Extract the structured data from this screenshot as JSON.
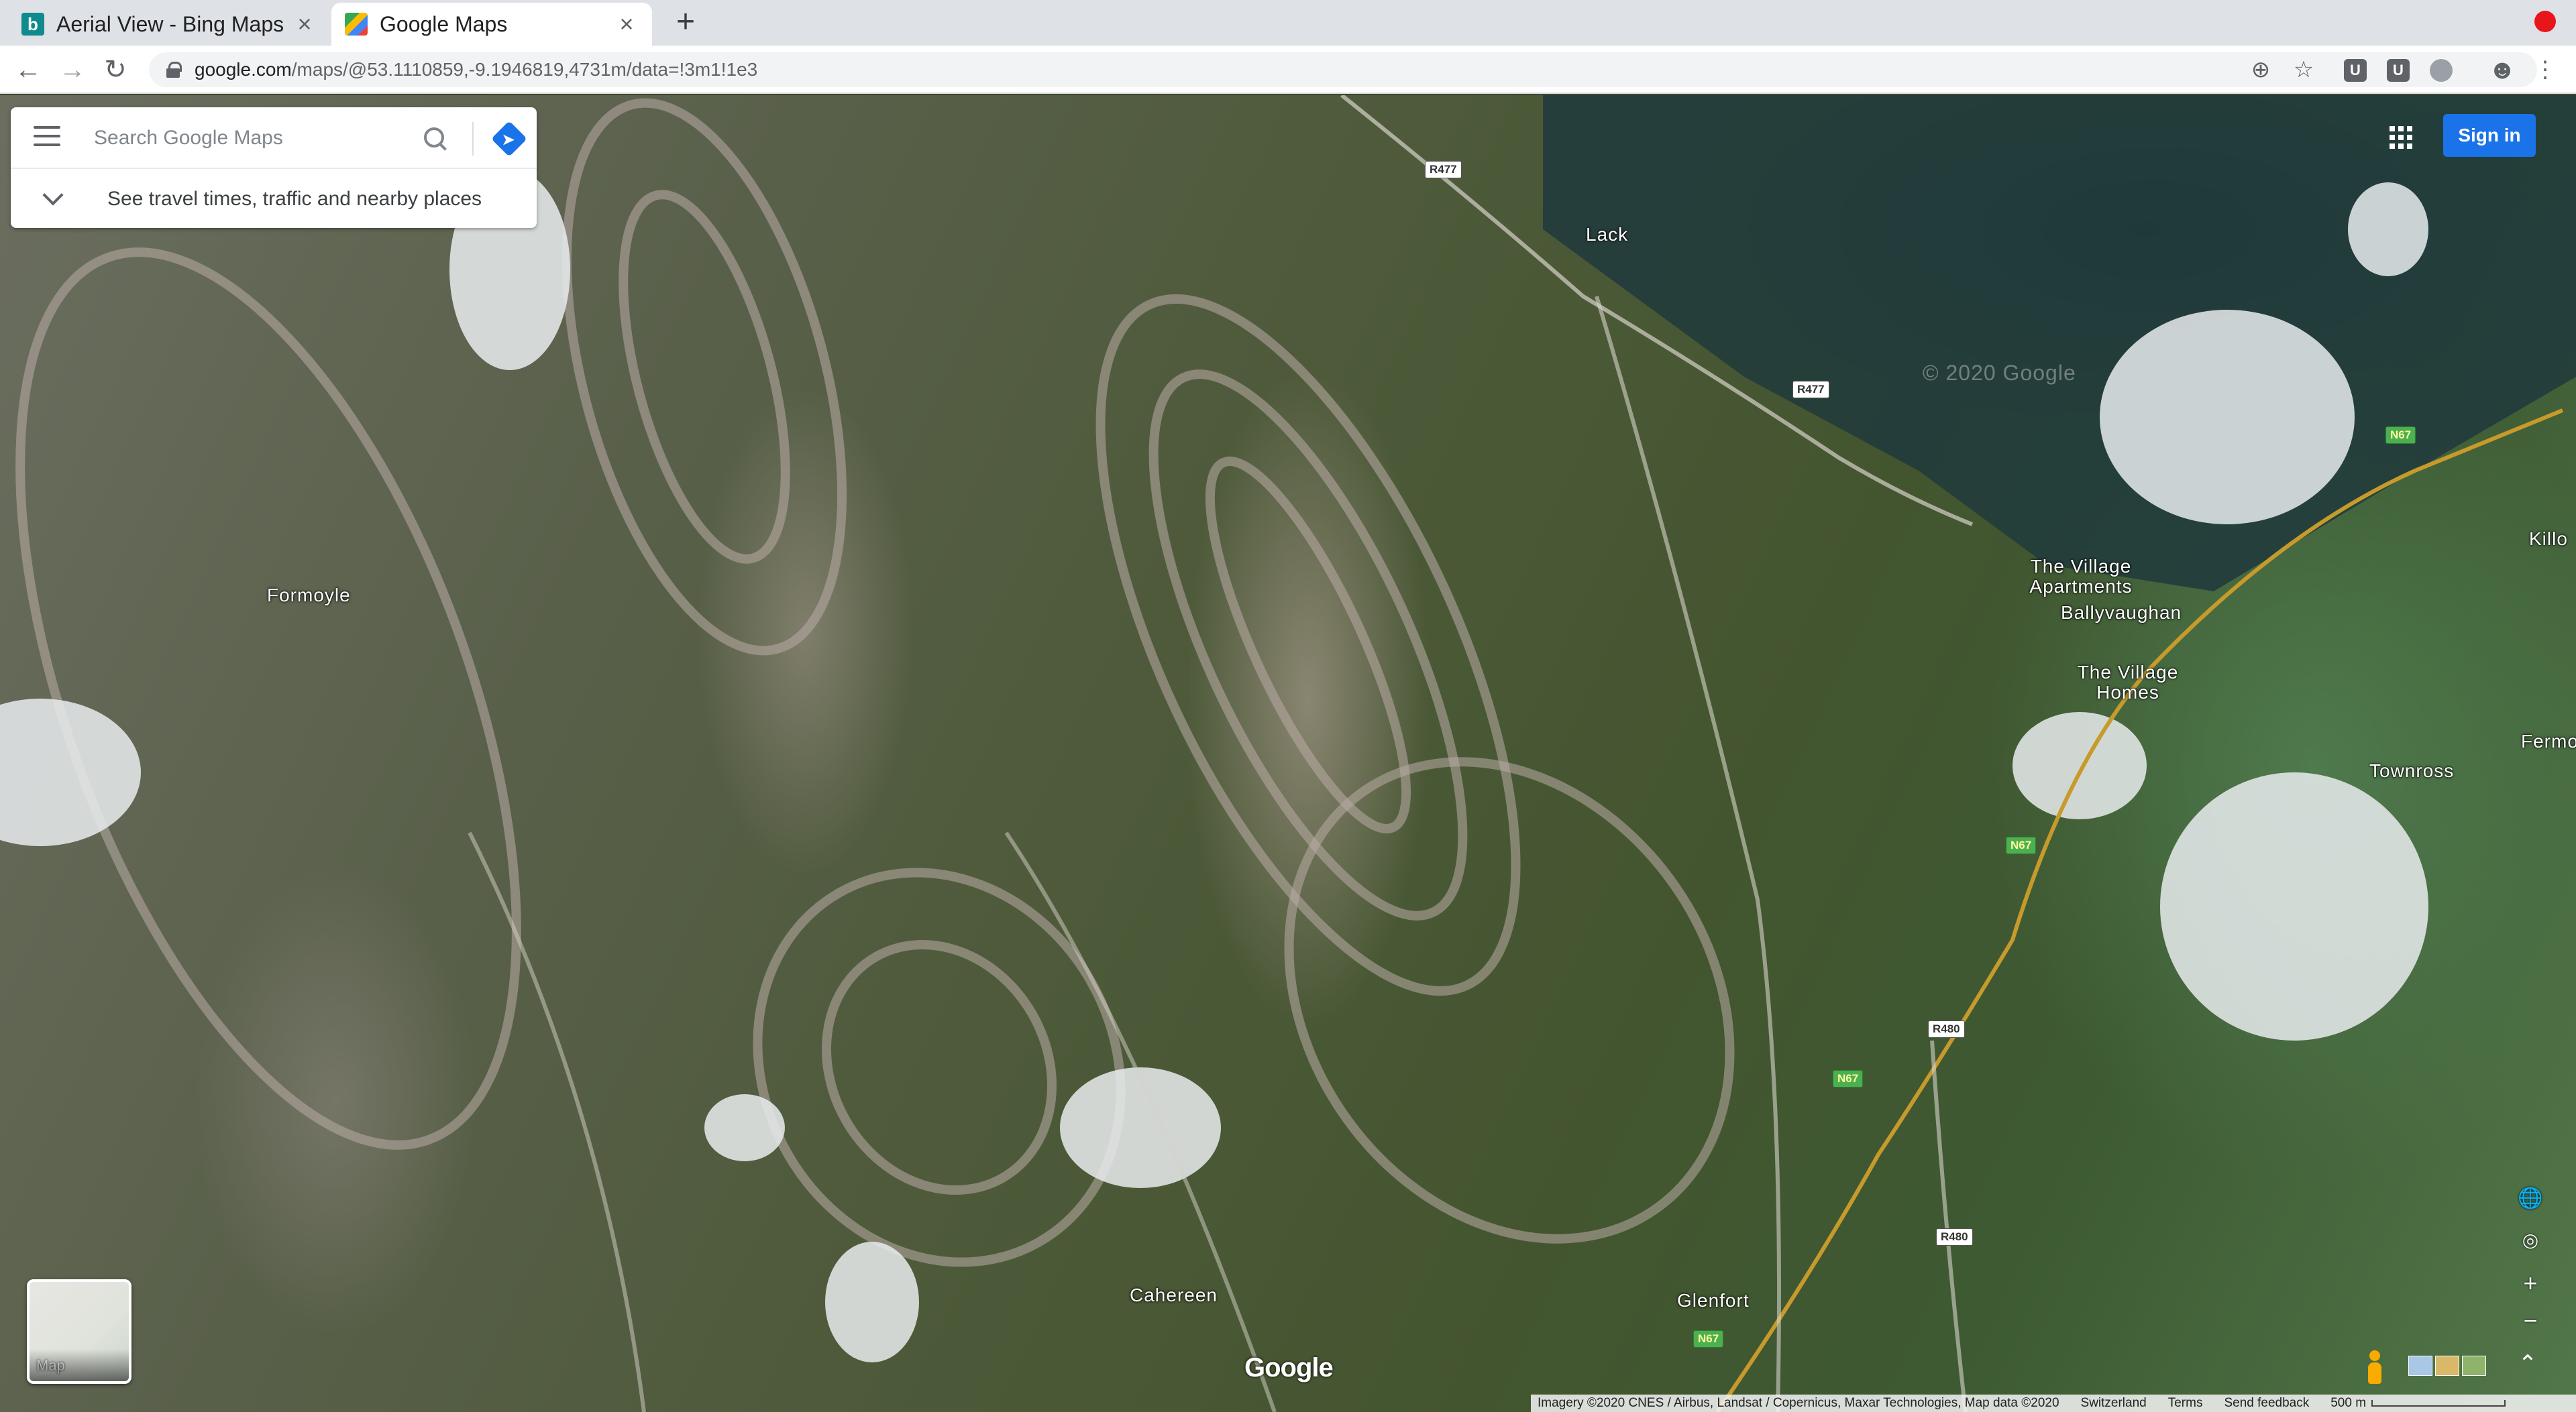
{
  "browser": {
    "tabs": [
      {
        "title": "Aerial View - Bing Maps",
        "active": false,
        "icon": "bing-icon"
      },
      {
        "title": "Google Maps",
        "active": true,
        "icon": "google-maps-icon"
      }
    ],
    "new_tab_label": "+",
    "close_label": "×",
    "url_host": "google.com",
    "url_path": "/maps/@53.1110859,-9.1946819,4731m/data=!3m1!1e3",
    "ext_u1": "U",
    "ext_u2": "U"
  },
  "search": {
    "placeholder": "Search Google Maps",
    "travel_text": "See travel times, traffic and nearby places"
  },
  "header": {
    "signin_label": "Sign in"
  },
  "places": [
    {
      "name": "Lack"
    },
    {
      "name": "Formoyle"
    },
    {
      "name": "The Village Apartments"
    },
    {
      "name": "Ballyvaughan"
    },
    {
      "name": "The Village Homes"
    },
    {
      "name": "Townross"
    },
    {
      "name": "Killo"
    },
    {
      "name": "Fermo"
    },
    {
      "name": "Cahereen"
    },
    {
      "name": "Glenfort"
    }
  ],
  "roads": [
    {
      "label": "R477"
    },
    {
      "label": "R477"
    },
    {
      "label": "N67"
    },
    {
      "label": "N67"
    },
    {
      "label": "N67"
    },
    {
      "label": "N67"
    },
    {
      "label": "R480"
    },
    {
      "label": "R480"
    }
  ],
  "watermark": "© 2020 Google",
  "layer_thumb_label": "Map",
  "logo": "Google",
  "footer": {
    "imagery": "Imagery ©2020 CNES / Airbus, Landsat / Copernicus, Maxar Technologies, Map data ©2020",
    "region": "Switzerland",
    "terms": "Terms",
    "feedback": "Send feedback",
    "scale": "500 m"
  },
  "controls": {
    "zoom_in": "+",
    "zoom_out": "−",
    "expand": "⌃"
  },
  "colors": {
    "accent": "#1a73e8",
    "national_road": "#4caf50",
    "record": "#e8161b"
  }
}
